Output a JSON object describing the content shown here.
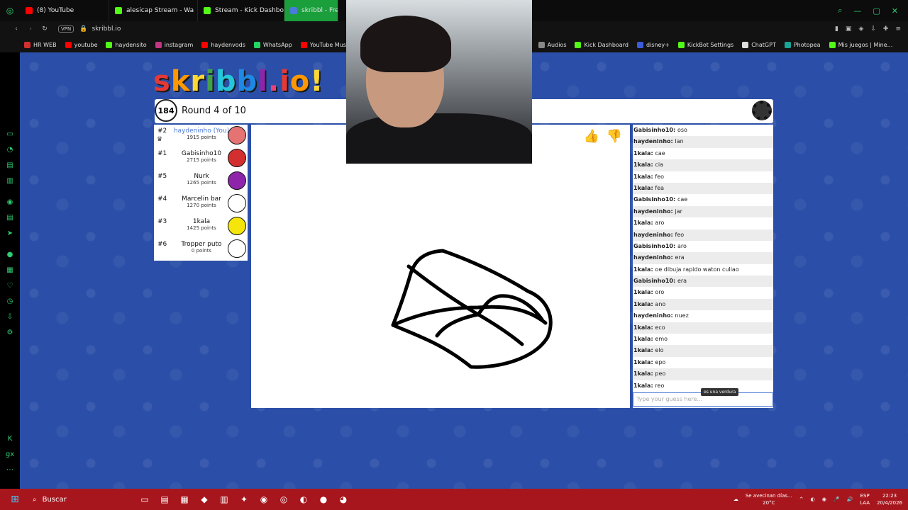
{
  "tabs": [
    {
      "label": "(8) YouTube",
      "color": "#ff0000"
    },
    {
      "label": "alesicap Stream - Wa",
      "color": "#53fc18"
    },
    {
      "label": "Stream - Kick Dashboard",
      "color": "#53fc18"
    },
    {
      "label": "skribbl - Free",
      "color": "#4b7bd8"
    }
  ],
  "address": {
    "vpn": "VPN",
    "url": "skribbl.io"
  },
  "bookmarks": [
    {
      "label": "HR WEB",
      "color": "#d32f2f"
    },
    {
      "label": "youtube",
      "color": "#ff0000"
    },
    {
      "label": "haydensito",
      "color": "#53fc18"
    },
    {
      "label": "instagram",
      "color": "#c13584"
    },
    {
      "label": "haydenvods",
      "color": "#ff0000"
    },
    {
      "label": "WhatsApp",
      "color": "#25d366"
    },
    {
      "label": "YouTube Music",
      "color": "#ff0000"
    },
    {
      "label": "Audios",
      "color": "#888888"
    },
    {
      "label": "Kick Dashboard",
      "color": "#53fc18"
    },
    {
      "label": "disney+",
      "color": "#3b5bdb"
    },
    {
      "label": "KickBot Settings",
      "color": "#53fc18"
    },
    {
      "label": "ChatGPT",
      "color": "#dddddd"
    },
    {
      "label": "Photopea",
      "color": "#18a497"
    },
    {
      "label": "Mis juegos | Mine...",
      "color": "#53fc18"
    }
  ],
  "game": {
    "timer": "184",
    "round": "Round 4 of 10",
    "input_placeholder": "Type your guess here...",
    "hint_popup": "es una verdura"
  },
  "players": [
    {
      "rank": "#2",
      "name": "haydeninho (You)",
      "points": "1915 points",
      "you": true,
      "color": "#e57373"
    },
    {
      "rank": "#1",
      "name": "Gabisinho10",
      "points": "2715 points",
      "you": false,
      "color": "#d32f2f"
    },
    {
      "rank": "#5",
      "name": "Nurk",
      "points": "1265 points",
      "you": false,
      "color": "#8e24aa"
    },
    {
      "rank": "#4",
      "name": "Marcelin bar",
      "points": "1270 points",
      "you": false,
      "color": "#ffffff"
    },
    {
      "rank": "#3",
      "name": "1kala",
      "points": "1425 points",
      "you": false,
      "color": "#f5e50a"
    },
    {
      "rank": "#6",
      "name": "Tropper puto",
      "points": "0 points",
      "you": false,
      "color": "#ffffff"
    }
  ],
  "chat": [
    {
      "user": "Gabisinho10",
      "text": "oso"
    },
    {
      "user": "haydeninho",
      "text": "lan"
    },
    {
      "user": "1kala",
      "text": "cae"
    },
    {
      "user": "1kala",
      "text": "cia"
    },
    {
      "user": "1kala",
      "text": "feo"
    },
    {
      "user": "1kala",
      "text": "fea"
    },
    {
      "user": "Gabisinho10",
      "text": "cae"
    },
    {
      "user": "haydeninho",
      "text": "jar"
    },
    {
      "user": "1kala",
      "text": "aro"
    },
    {
      "user": "haydeninho",
      "text": "feo"
    },
    {
      "user": "Gabisinho10",
      "text": "aro"
    },
    {
      "user": "haydeninho",
      "text": "era"
    },
    {
      "user": "1kala",
      "text": "oe dibuja rapido waton culiao"
    },
    {
      "user": "Gabisinho10",
      "text": "era"
    },
    {
      "user": "1kala",
      "text": "oro"
    },
    {
      "user": "1kala",
      "text": "ano"
    },
    {
      "user": "haydeninho",
      "text": "nuez"
    },
    {
      "user": "1kala",
      "text": "eco"
    },
    {
      "user": "1kala",
      "text": "emo"
    },
    {
      "user": "1kala",
      "text": "elo"
    },
    {
      "user": "1kala",
      "text": "epo"
    },
    {
      "user": "1kala",
      "text": "peo"
    },
    {
      "user": "1kala",
      "text": "reo"
    }
  ],
  "taskbar": {
    "search": "Buscar",
    "weather": "Se avecinan días...",
    "temp": "20°C",
    "lang": "ESP",
    "lang2": "LAA",
    "time": "22:23",
    "date": "20/4/2026"
  }
}
